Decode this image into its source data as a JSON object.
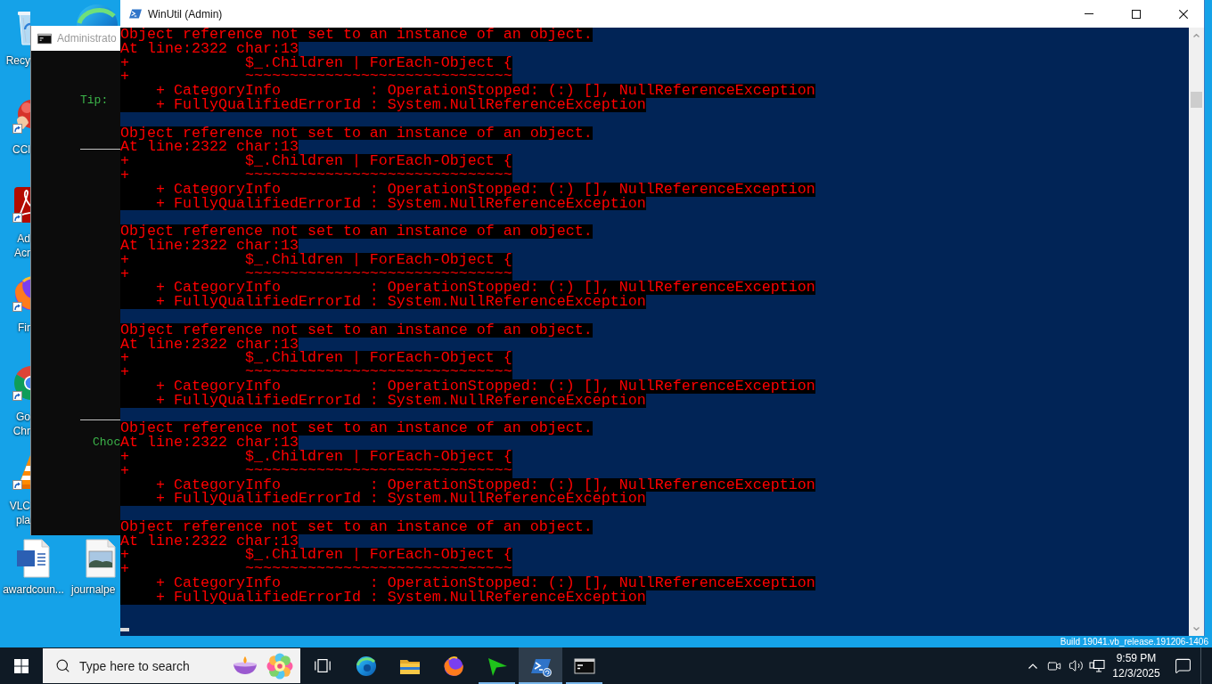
{
  "desktop": {
    "icon_column": [
      {
        "kind": "recycle-bin",
        "label": "Recy",
        "shortcut": false
      },
      {
        "kind": "cleaner",
        "label": "CCl",
        "shortcut": true
      },
      {
        "kind": "pdf-reader",
        "label": "Ad Acr",
        "shortcut": true
      },
      {
        "kind": "fox-browser",
        "label": "Fir",
        "shortcut": true
      },
      {
        "kind": "ring-browser",
        "label": "Go Chr",
        "shortcut": true
      },
      {
        "kind": "cone-player",
        "label": "VLC pla",
        "shortcut": true
      }
    ],
    "bottom_icons": [
      {
        "kind": "word-document",
        "label": "awardcoun...",
        "shortcut": false
      },
      {
        "kind": "image-file",
        "label": "journalpe",
        "shortcut": false
      }
    ],
    "build_text": "Build 19041.vb_release.191206-1406"
  },
  "cmd_window": {
    "title": "Administrato",
    "lines": [
      "Tip:",
      "Choc"
    ]
  },
  "winutil_window": {
    "title": "WinUtil (Admin)",
    "console": {
      "blocks": [
        {
          "lines": [
            "Object reference not set to an instance of an object.",
            "At line:2322 char:13",
            "+             $_.Children | ForEach-Object {",
            "+             ~~~~~~~~~~~~~~~~~~~~~~~~~~~~~~",
            "    + CategoryInfo          : OperationStopped: (:) [], NullReferenceException",
            "    + FullyQualifiedErrorId : System.NullReferenceException"
          ]
        },
        {
          "lines": [
            "Object reference not set to an instance of an object.",
            "At line:2322 char:13",
            "+             $_.Children | ForEach-Object {",
            "+             ~~~~~~~~~~~~~~~~~~~~~~~~~~~~~~",
            "    + CategoryInfo          : OperationStopped: (:) [], NullReferenceException",
            "    + FullyQualifiedErrorId : System.NullReferenceException"
          ]
        },
        {
          "lines": [
            "Object reference not set to an instance of an object.",
            "At line:2322 char:13",
            "+             $_.Children | ForEach-Object {",
            "+             ~~~~~~~~~~~~~~~~~~~~~~~~~~~~~~",
            "    + CategoryInfo          : OperationStopped: (:) [], NullReferenceException",
            "    + FullyQualifiedErrorId : System.NullReferenceException"
          ]
        },
        {
          "lines": [
            "Object reference not set to an instance of an object.",
            "At line:2322 char:13",
            "+             $_.Children | ForEach-Object {",
            "+             ~~~~~~~~~~~~~~~~~~~~~~~~~~~~~~",
            "    + CategoryInfo          : OperationStopped: (:) [], NullReferenceException",
            "    + FullyQualifiedErrorId : System.NullReferenceException"
          ]
        },
        {
          "lines": [
            "Object reference not set to an instance of an object.",
            "At line:2322 char:13",
            "+             $_.Children | ForEach-Object {",
            "+             ~~~~~~~~~~~~~~~~~~~~~~~~~~~~~~",
            "    + CategoryInfo          : OperationStopped: (:) [], NullReferenceException",
            "    + FullyQualifiedErrorId : System.NullReferenceException"
          ]
        },
        {
          "lines": [
            "Object reference not set to an instance of an object.",
            "At line:2322 char:13",
            "+             $_.Children | ForEach-Object {",
            "+             ~~~~~~~~~~~~~~~~~~~~~~~~~~~~~~",
            "    + CategoryInfo          : OperationStopped: (:) [], NullReferenceException",
            "    + FullyQualifiedErrorId : System.NullReferenceException"
          ]
        }
      ]
    }
  },
  "taskbar": {
    "search": {
      "placeholder": "Type here to search"
    },
    "apps": [
      {
        "kind": "swirl-browser",
        "running": false,
        "selected": false
      },
      {
        "kind": "folder",
        "running": false,
        "selected": false
      },
      {
        "kind": "fox-browser",
        "running": false,
        "selected": false
      },
      {
        "kind": "arrow",
        "running": true,
        "selected": false
      },
      {
        "kind": "terminal",
        "running": true,
        "selected": true
      },
      {
        "kind": "console",
        "running": true,
        "selected": false
      }
    ],
    "clock": {
      "time": "9:59 PM",
      "date": "12/3/2025"
    }
  }
}
